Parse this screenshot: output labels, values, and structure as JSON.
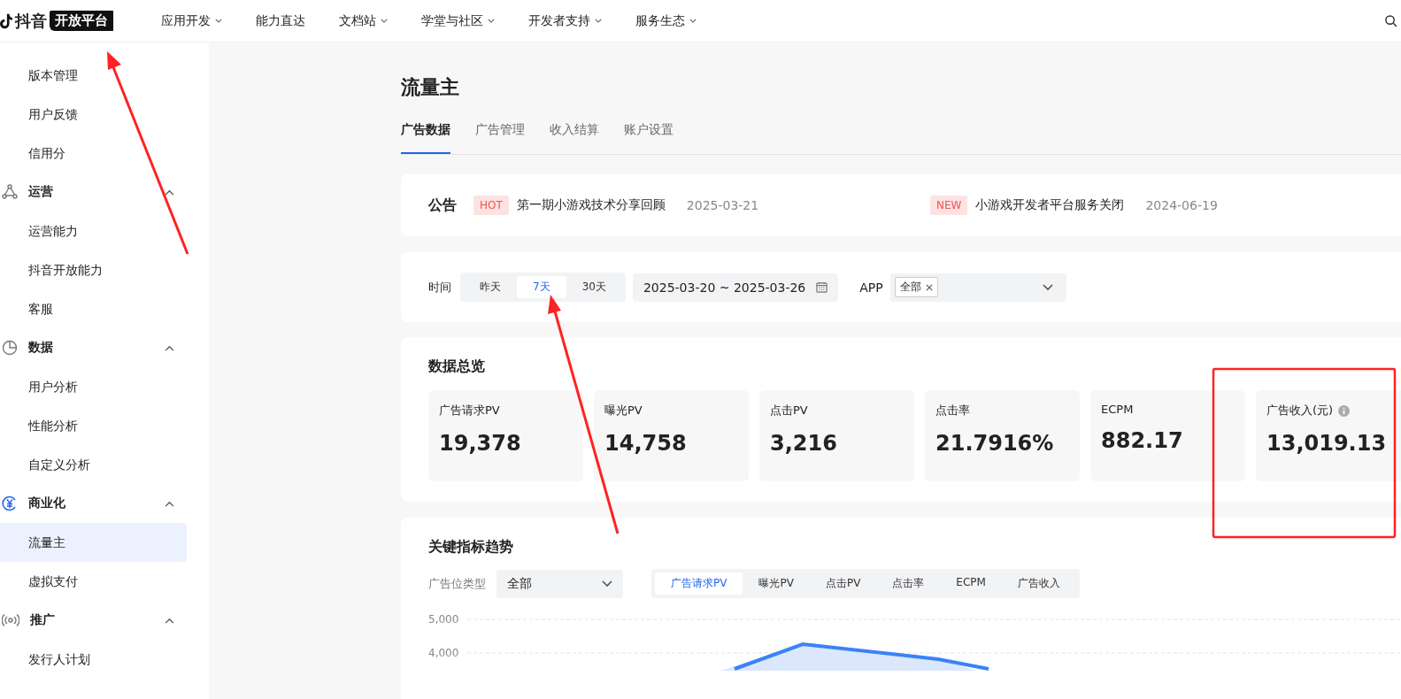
{
  "top_nav": {
    "logo": {
      "name": "抖音",
      "badge": "开放平台"
    },
    "items": [
      {
        "label": "应用开发",
        "has_menu": true
      },
      {
        "label": "能力直达",
        "has_menu": false
      },
      {
        "label": "文档站",
        "has_menu": true
      },
      {
        "label": "学堂与社区",
        "has_menu": true
      },
      {
        "label": "开发者支持",
        "has_menu": true
      },
      {
        "label": "服务生态",
        "has_menu": true
      }
    ]
  },
  "sidebar": {
    "items": [
      {
        "kind": "item",
        "label": "版本管理",
        "selected": false
      },
      {
        "kind": "item",
        "label": "用户反馈",
        "selected": false
      },
      {
        "kind": "item",
        "label": "信用分",
        "selected": false
      },
      {
        "kind": "group",
        "label": "运营",
        "expanded": true,
        "active": false,
        "children": [
          {
            "kind": "item",
            "label": "运营能力",
            "selected": false
          },
          {
            "kind": "item",
            "label": "抖音开放能力",
            "selected": false
          },
          {
            "kind": "item",
            "label": "客服",
            "selected": false
          }
        ]
      },
      {
        "kind": "group",
        "label": "数据",
        "expanded": true,
        "active": false,
        "children": [
          {
            "kind": "item",
            "label": "用户分析",
            "selected": false
          },
          {
            "kind": "item",
            "label": "性能分析",
            "selected": false
          },
          {
            "kind": "item",
            "label": "自定义分析",
            "selected": false
          }
        ]
      },
      {
        "kind": "group",
        "label": "商业化",
        "expanded": true,
        "active": true,
        "children": [
          {
            "kind": "item",
            "label": "流量主",
            "selected": true
          },
          {
            "kind": "item",
            "label": "虚拟支付",
            "selected": false
          }
        ]
      },
      {
        "kind": "group",
        "label": "推广",
        "expanded": true,
        "active": false,
        "children": [
          {
            "kind": "item",
            "label": "发行人计划",
            "selected": false
          }
        ]
      }
    ]
  },
  "page": {
    "title": "流量主",
    "tabs": [
      {
        "label": "广告数据",
        "selected": true
      },
      {
        "label": "广告管理",
        "selected": false
      },
      {
        "label": "收入结算",
        "selected": false
      },
      {
        "label": "账户设置",
        "selected": false
      }
    ],
    "announcements": {
      "title": "公告",
      "items": [
        {
          "tag": "HOT",
          "text": "第一期小游戏技术分享回顾",
          "date": "2025-03-21"
        },
        {
          "tag": "NEW",
          "text": "小游戏开发者平台服务关闭",
          "date": "2024-06-19"
        }
      ]
    },
    "filters": {
      "time_label": "时间",
      "ranges": [
        {
          "label": "昨天",
          "selected": false
        },
        {
          "label": "7天",
          "selected": true
        },
        {
          "label": "30天",
          "selected": false
        }
      ],
      "date_range": "2025-03-20 ~ 2025-03-26",
      "app_label": "APP",
      "app_tags": [
        "全部"
      ]
    },
    "overview": {
      "title": "数据总览",
      "metrics": [
        {
          "label": "广告请求PV",
          "value": "19,378",
          "info": false
        },
        {
          "label": "曝光PV",
          "value": "14,758",
          "info": false
        },
        {
          "label": "点击PV",
          "value": "3,216",
          "info": false
        },
        {
          "label": "点击率",
          "value": "21.7916%",
          "info": false
        },
        {
          "label": "ECPM",
          "value": "882.17",
          "info": false
        },
        {
          "label": "广告收入(元)",
          "value": "13,019.13",
          "info": true
        }
      ]
    },
    "trend": {
      "title": "关键指标趋势",
      "slot_label": "广告位类型",
      "slot_value": "全部",
      "metric_tabs": [
        {
          "label": "广告请求PV",
          "selected": true
        },
        {
          "label": "曝光PV",
          "selected": false
        },
        {
          "label": "点击PV",
          "selected": false
        },
        {
          "label": "点击率",
          "selected": false
        },
        {
          "label": "ECPM",
          "selected": false
        },
        {
          "label": "广告收入",
          "selected": false
        }
      ],
      "y_axis_labels": [
        "5,000",
        "4,000"
      ]
    }
  }
}
